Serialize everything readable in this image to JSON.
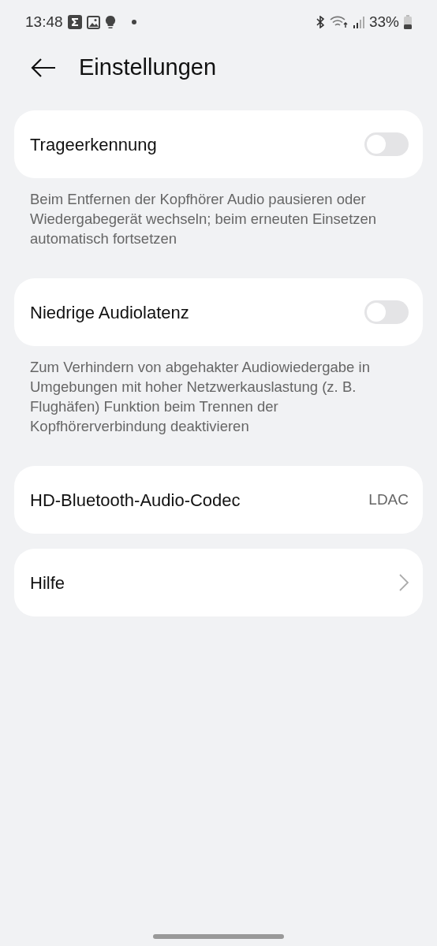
{
  "status_bar": {
    "time": "13:48",
    "battery": "33%"
  },
  "header": {
    "title": "Einstellungen"
  },
  "items": [
    {
      "kind": "toggle",
      "label": "Trageerkennung",
      "on": false,
      "description": "Beim Entfernen der Kopfhörer Audio pausieren oder Wiedergabegerät wechseln; beim erneuten Einsetzen automatisch fortsetzen"
    },
    {
      "kind": "toggle",
      "label": "Niedrige Audiolatenz",
      "on": false,
      "description": "Zum Verhindern von abgehakter Audiowiedergabe in Umgebungen mit hoher Netzwerkauslastung (z. B. Flughäfen) Funktion beim Trennen der Kopfhörerverbindung deaktivieren"
    },
    {
      "kind": "value",
      "label": "HD-Bluetooth-Audio-Codec",
      "value": "LDAC"
    },
    {
      "kind": "link",
      "label": "Hilfe"
    }
  ]
}
